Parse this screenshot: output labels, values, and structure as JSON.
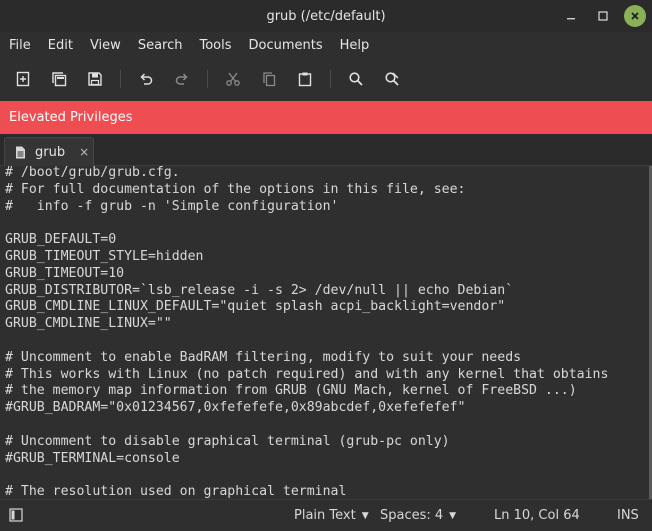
{
  "window": {
    "title": "grub (/etc/default)"
  },
  "menu": [
    "File",
    "Edit",
    "View",
    "Search",
    "Tools",
    "Documents",
    "Help"
  ],
  "toolbar_icons": [
    "new-document-icon",
    "new-window-icon",
    "save-icon",
    "undo-icon",
    "redo-icon",
    "cut-icon",
    "copy-icon",
    "paste-icon",
    "search-icon",
    "replace-icon"
  ],
  "banner": {
    "text": "Elevated Privileges",
    "color": "#ee4d52"
  },
  "tab": {
    "label": "grub",
    "close": "×"
  },
  "editor": {
    "lines": [
      "# /boot/grub/grub.cfg.",
      "# For full documentation of the options in this file, see:",
      "#   info -f grub -n 'Simple configuration'",
      "",
      "GRUB_DEFAULT=0",
      "GRUB_TIMEOUT_STYLE=hidden",
      "GRUB_TIMEOUT=10",
      "GRUB_DISTRIBUTOR=`lsb_release -i -s 2> /dev/null || echo Debian`",
      "GRUB_CMDLINE_LINUX_DEFAULT=\"quiet splash acpi_backlight=vendor\"",
      "GRUB_CMDLINE_LINUX=\"\"",
      "",
      "# Uncomment to enable BadRAM filtering, modify to suit your needs",
      "# This works with Linux (no patch required) and with any kernel that obtains",
      "# the memory map information from GRUB (GNU Mach, kernel of FreeBSD ...)",
      "#GRUB_BADRAM=\"0x01234567,0xfefefefe,0x89abcdef,0xefefefef\"",
      "",
      "# Uncomment to disable graphical terminal (grub-pc only)",
      "#GRUB_TERMINAL=console",
      "",
      "# The resolution used on graphical terminal"
    ]
  },
  "status": {
    "language": "Plain Text",
    "spaces": "Spaces: 4",
    "position": "Ln 10, Col 64",
    "mode": "INS"
  }
}
